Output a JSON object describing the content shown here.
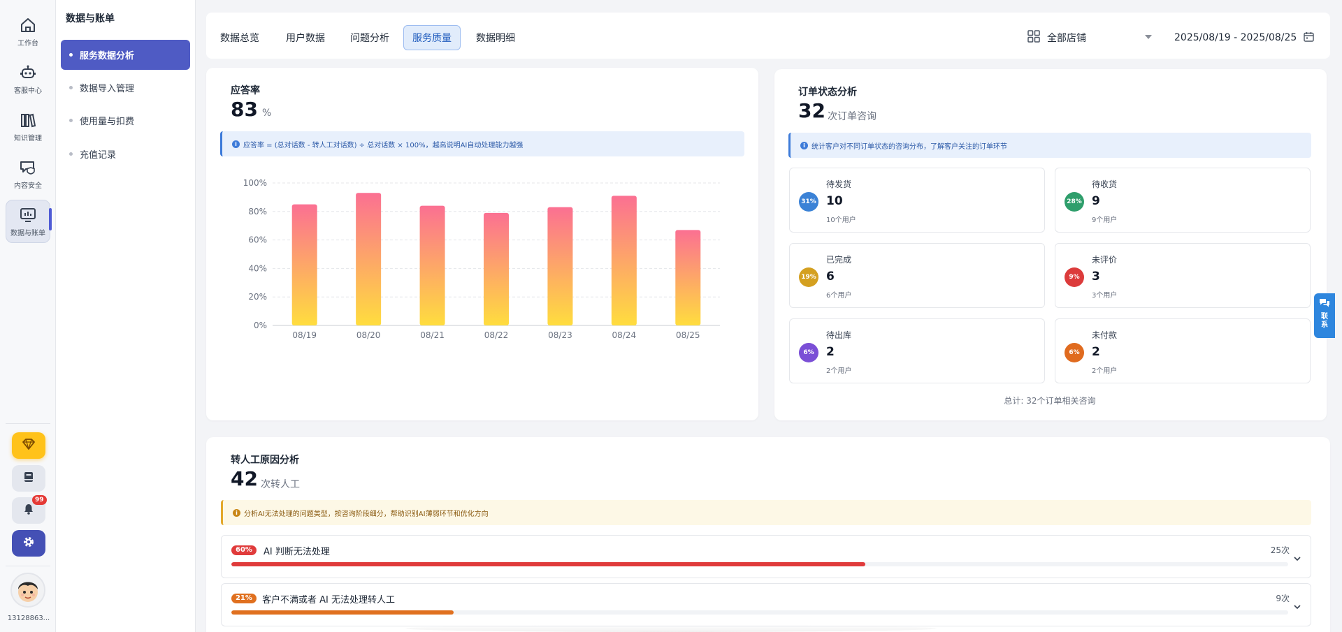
{
  "rail": {
    "items": [
      {
        "label": "工作台",
        "icon": "home-icon"
      },
      {
        "label": "客服中心",
        "icon": "robot-icon"
      },
      {
        "label": "知识管理",
        "icon": "books-icon"
      },
      {
        "label": "内容安全",
        "icon": "shield-message-icon"
      },
      {
        "label": "数据与账单",
        "icon": "monitor-chart-icon",
        "active": true
      }
    ],
    "notification_count": "99",
    "user_id": "13128863..."
  },
  "submenu": {
    "title": "数据与账单",
    "items": [
      {
        "label": "服务数据分析",
        "active": true
      },
      {
        "label": "数据导入管理"
      },
      {
        "label": "使用量与扣费"
      },
      {
        "label": "充值记录"
      }
    ]
  },
  "tabs": [
    {
      "label": "数据总览"
    },
    {
      "label": "用户数据"
    },
    {
      "label": "问题分析"
    },
    {
      "label": "服务质量",
      "active": true
    },
    {
      "label": "数据明细"
    }
  ],
  "filters": {
    "store": "全部店铺",
    "date_range": "2025/08/19 - 2025/08/25"
  },
  "response_card": {
    "title": "应答率",
    "value": "83",
    "unit": "%",
    "info": "应答率 = (总对话数 - 转人工对话数) ÷ 总对话数 × 100%，越高说明AI自动处理能力越强"
  },
  "chart_data": {
    "type": "bar",
    "categories": [
      "08/19",
      "08/20",
      "08/21",
      "08/22",
      "08/23",
      "08/24",
      "08/25"
    ],
    "values": [
      85,
      93,
      84,
      79,
      83,
      91,
      67
    ],
    "ylim": [
      0,
      100
    ],
    "yticks": [
      "0%",
      "20%",
      "40%",
      "60%",
      "80%",
      "100%"
    ],
    "grid": true,
    "gradient_top": "#fb7092",
    "gradient_bottom": "#ffdd3e"
  },
  "order_card": {
    "title": "订单状态分析",
    "value": "32",
    "unit": "次订单咨询",
    "info": "统计客户对不同订单状态的咨询分布，了解客户关注的订单环节",
    "statuses": [
      {
        "name": "待发货",
        "count": "10",
        "users": "10个用户",
        "pct": "31%",
        "color": "#3b82d6"
      },
      {
        "name": "待收货",
        "count": "9",
        "users": "9个用户",
        "pct": "28%",
        "color": "#2e9e6b"
      },
      {
        "name": "已完成",
        "count": "6",
        "users": "6个用户",
        "pct": "19%",
        "color": "#d4a020"
      },
      {
        "name": "未评价",
        "count": "3",
        "users": "3个用户",
        "pct": "9%",
        "color": "#dc3b3b"
      },
      {
        "name": "待出库",
        "count": "2",
        "users": "2个用户",
        "pct": "6%",
        "color": "#7b4fd6"
      },
      {
        "name": "未付款",
        "count": "2",
        "users": "2个用户",
        "pct": "6%",
        "color": "#e06b1f"
      }
    ],
    "total": "总计: 32个订单相关咨询"
  },
  "transfer_card": {
    "title": "转人工原因分析",
    "value": "42",
    "unit": "次转人工",
    "info": "分析AI无法处理的问题类型，按咨询阶段细分，帮助识别AI薄弱环节和优化方向",
    "reasons": [
      {
        "pct": "60%",
        "label": "AI 判断无法处理",
        "count": "25次",
        "fill": 0.6,
        "color": "#e03b3b"
      },
      {
        "pct": "21%",
        "label": "客户不满或者 AI 无法处理转人工",
        "count": "9次",
        "fill": 0.21,
        "color": "#e0701f"
      }
    ]
  },
  "contact": {
    "label": "联系"
  },
  "colors": {
    "accent": "#4f5bc4",
    "tab_active_bg": "#e1ecfb",
    "vip": "#ffc21a"
  }
}
